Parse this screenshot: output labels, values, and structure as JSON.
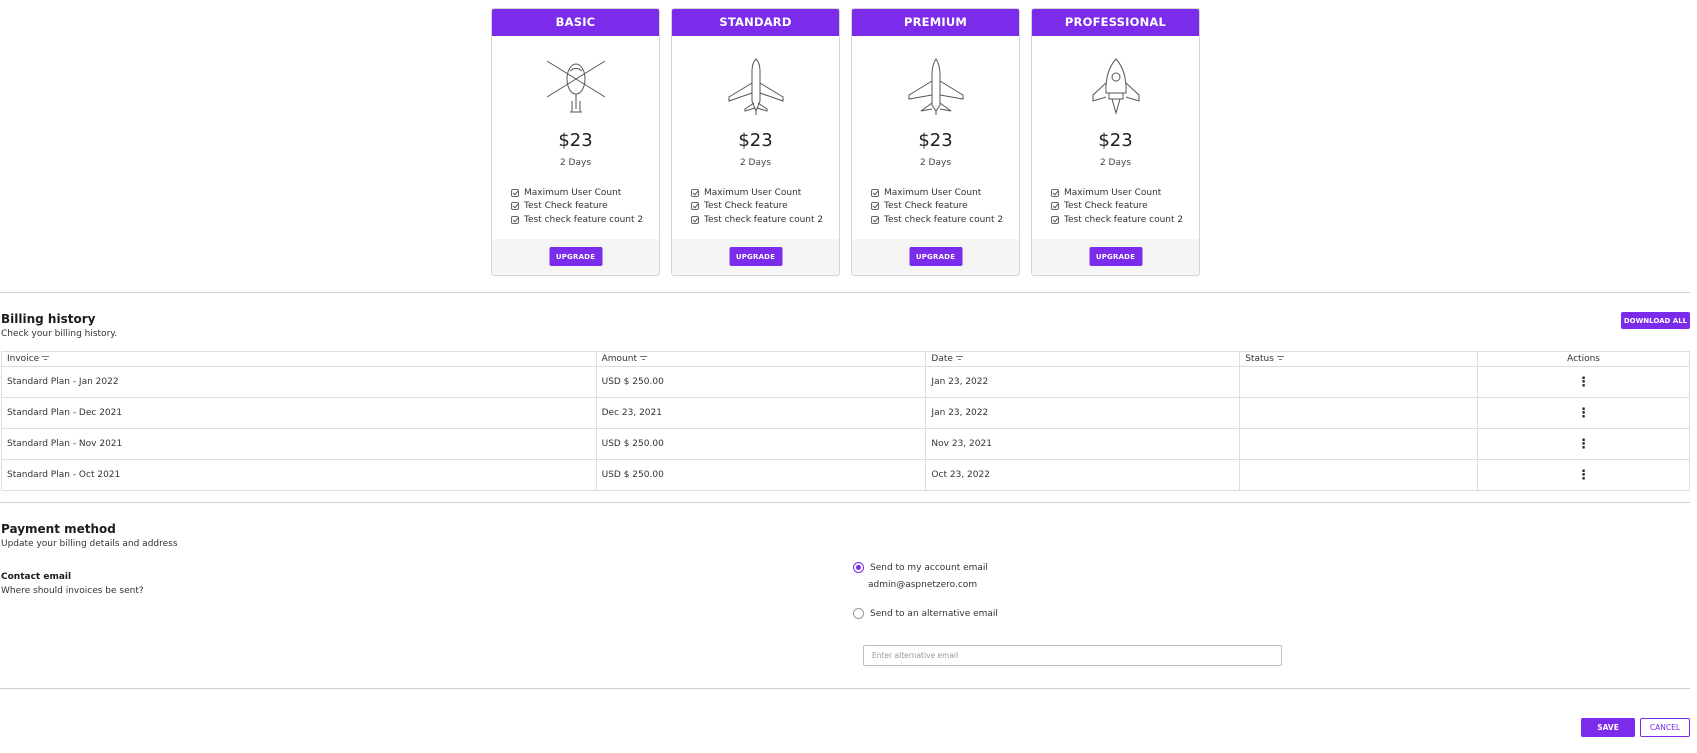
{
  "accent_color": "#7b2bea",
  "plans": [
    {
      "name": "BASIC",
      "icon": "helicopter-icon",
      "price": "$23",
      "period": "2 Days",
      "features": [
        "Maximum User Count",
        "Test Check feature",
        "Test check feature count 2"
      ],
      "button": "UPGRADE"
    },
    {
      "name": "STANDARD",
      "icon": "airplane-icon",
      "price": "$23",
      "period": "2 Days",
      "features": [
        "Maximum User Count",
        "Test Check feature",
        "Test check feature count 2"
      ],
      "button": "UPGRADE"
    },
    {
      "name": "PREMIUM",
      "icon": "jet-icon",
      "price": "$23",
      "period": "2 Days",
      "features": [
        "Maximum User Count",
        "Test Check feature",
        "Test check feature count 2"
      ],
      "button": "UPGRADE"
    },
    {
      "name": "PROFESSIONAL",
      "icon": "rocket-icon",
      "price": "$23",
      "period": "2 Days",
      "features": [
        "Maximum User Count",
        "Test Check feature",
        "Test check feature count 2"
      ],
      "button": "UPGRADE"
    }
  ],
  "billing": {
    "title": "Billing history",
    "subtitle": "Check your billing history.",
    "download_all": "DOWNLOAD ALL",
    "columns": [
      "Invoice",
      "Amount",
      "Date",
      "Status",
      "Actions"
    ],
    "rows": [
      {
        "invoice": "Standard Plan - Jan 2022",
        "amount": "USD $ 250.00",
        "date": "Jan 23, 2022",
        "status": ""
      },
      {
        "invoice": "Standard Plan - Dec 2021",
        "amount": "Dec 23, 2021",
        "date": "Jan 23, 2022",
        "status": ""
      },
      {
        "invoice": "Standard Plan - Nov 2021",
        "amount": "USD $ 250.00",
        "date": "Nov 23, 2021",
        "status": ""
      },
      {
        "invoice": "Standard Plan - Oct 2021",
        "amount": "USD $ 250.00",
        "date": "Oct 23, 2022",
        "status": ""
      }
    ]
  },
  "payment": {
    "title": "Payment method",
    "subtitle": "Update your billing details and address",
    "contact_label": "Contact email",
    "contact_sub": "Where should invoices be sent?",
    "option_account": "Send to my account email",
    "account_email": "admin@aspnetzero.com",
    "option_alternative": "Send to an alternative email",
    "alt_placeholder": "Enter alternative email",
    "alt_value": "",
    "selected_option": "account"
  },
  "actions": {
    "save": "SAVE",
    "cancel": "CANCEL"
  }
}
